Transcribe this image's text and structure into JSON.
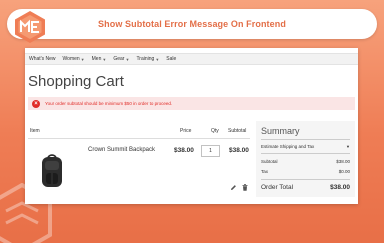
{
  "banner": {
    "title": "Show Subtotal Error Message On Frontend"
  },
  "nav": {
    "items": [
      {
        "label": "What's New",
        "has_dropdown": false
      },
      {
        "label": "Women",
        "has_dropdown": true
      },
      {
        "label": "Men",
        "has_dropdown": true
      },
      {
        "label": "Gear",
        "has_dropdown": true
      },
      {
        "label": "Training",
        "has_dropdown": true
      },
      {
        "label": "Sale",
        "has_dropdown": false
      }
    ]
  },
  "page_title": "Shopping Cart",
  "alert": {
    "message": "Your order subtotal should be minimum $50 in order to proceed.",
    "color": "#e02b27"
  },
  "cart": {
    "columns": {
      "item": "Item",
      "price": "Price",
      "qty": "Qty",
      "subtotal": "Subtotal"
    },
    "items": [
      {
        "name": "Crown Summit Backpack",
        "price": "$38.00",
        "qty": "1",
        "subtotal": "$38.00"
      }
    ]
  },
  "summary": {
    "title": "Summary",
    "shipping_label": "Estimate Shipping and Tax",
    "subtotal_label": "Subtotal",
    "subtotal_value": "$38.00",
    "tax_label": "Tax",
    "tax_value": "$0.00",
    "order_total_label": "Order Total",
    "order_total_value": "$38.00"
  },
  "colors": {
    "brand": "#e36f48",
    "background_top": "#f7a27c",
    "background_bottom": "#e86f47"
  }
}
